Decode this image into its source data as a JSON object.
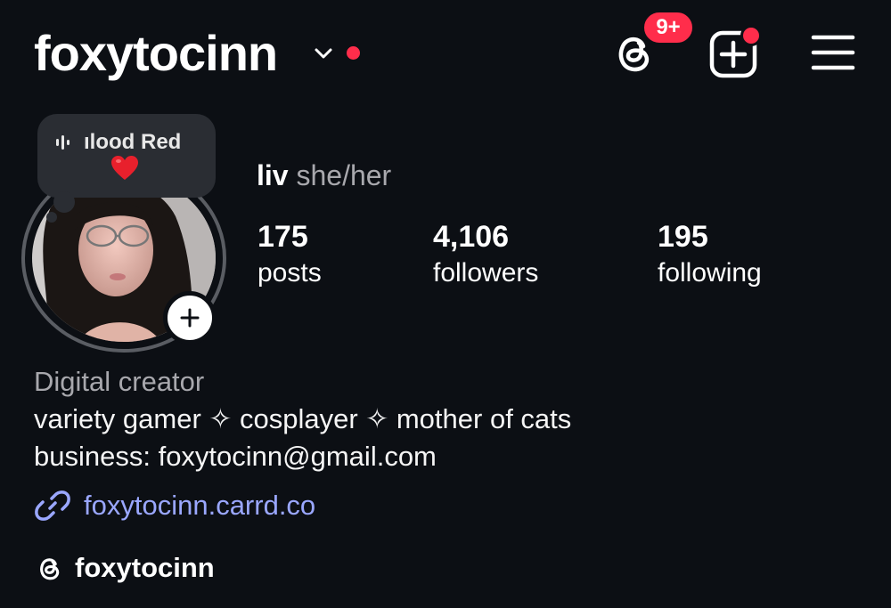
{
  "header": {
    "username": "foxytocinn",
    "threads_badge": "9+",
    "icons": [
      "chevron-down-icon",
      "threads-icon",
      "create-post-icon",
      "menu-icon"
    ]
  },
  "note": {
    "text": "ılood Red",
    "emoji": "heart"
  },
  "profile": {
    "name": "liv",
    "pronouns": "she/her"
  },
  "stats": [
    {
      "value": "175",
      "label": "posts"
    },
    {
      "value": "4,106",
      "label": "followers"
    },
    {
      "value": "195",
      "label": "following"
    }
  ],
  "bio": {
    "category": "Digital creator",
    "line1": "variety gamer ✧ cosplayer ✧ mother of cats",
    "line2": "business: foxytocinn@gmail.com",
    "link": "foxytocinn.carrd.co",
    "threads_handle": "foxytocinn"
  },
  "colors": {
    "background": "#0c0f14",
    "accent_red": "#ff2d4b",
    "link_blue": "#9aa7ff",
    "muted": "#a8a8ad"
  }
}
